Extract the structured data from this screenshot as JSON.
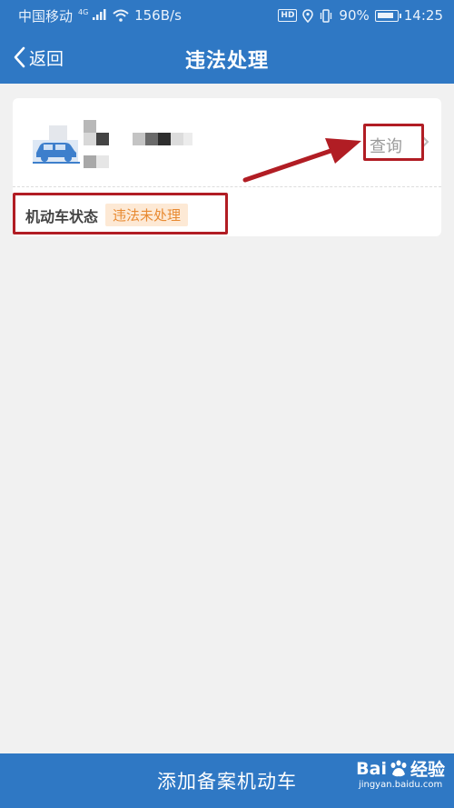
{
  "status_bar": {
    "carrier": "中国移动",
    "network": "4G",
    "speed": "156B/s",
    "hd": "HD",
    "battery": "90%",
    "time": "14:25"
  },
  "nav": {
    "back_label": "返回",
    "title": "违法处理"
  },
  "vehicle_card": {
    "query_label": "查询",
    "status_label": "机动车状态",
    "status_value": "违法未处理"
  },
  "bottom": {
    "add_label": "添加备案机动车"
  },
  "watermark": {
    "brand_left": "Bai",
    "brand_right": "经验",
    "url": "jingyan.baidu.com"
  },
  "colors": {
    "primary": "#2f78c4",
    "annotation": "#b11d24",
    "badge_text": "#e88a32",
    "badge_bg": "#fde9d5"
  }
}
